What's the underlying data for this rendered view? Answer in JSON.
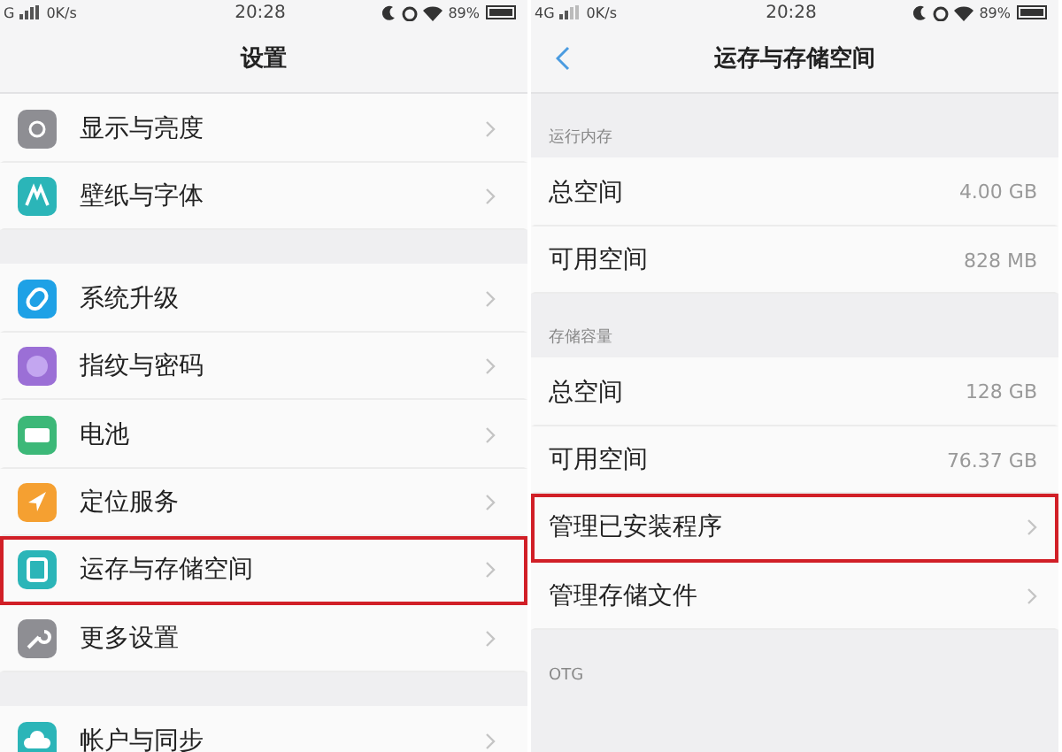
{
  "settings_screen": {
    "status_bar": {
      "network": "G",
      "speed": "0K/s",
      "time": "20:28",
      "battery": "89%"
    },
    "title": "设置",
    "groups": [
      {
        "items": [
          {
            "label": "显示与亮度",
            "color": "#8e8e93",
            "highlighted": false
          },
          {
            "label": "壁纸与字体",
            "color": "#2bb5b8",
            "highlighted": false
          }
        ]
      },
      {
        "items": [
          {
            "label": "系统升级",
            "color": "#1ea1e6",
            "highlighted": false
          },
          {
            "label": "指纹与密码",
            "color": "#9b6fd6",
            "highlighted": false
          },
          {
            "label": "电池",
            "color": "#3cb878",
            "highlighted": false
          },
          {
            "label": "定位服务",
            "color": "#f5a031",
            "highlighted": false
          },
          {
            "label": "运存与存储空间",
            "color": "#2bb5b8",
            "highlighted": true
          },
          {
            "label": "更多设置",
            "color": "#8e8e93",
            "highlighted": false
          }
        ]
      },
      {
        "items": [
          {
            "label": "帐户与同步",
            "color": "#2bb5b8",
            "highlighted": false
          }
        ]
      }
    ]
  },
  "storage_screen": {
    "status_bar": {
      "network": "4G",
      "speed": "0K/s",
      "time": "20:28",
      "battery": "89%"
    },
    "title": "运存与存储空间",
    "sections": [
      {
        "header": "运行内存",
        "rows": [
          {
            "kind": "value",
            "label": "总空间",
            "value": "4.00 GB",
            "highlighted": false
          },
          {
            "kind": "value",
            "label": "可用空间",
            "value": "828 MB",
            "highlighted": false
          }
        ]
      },
      {
        "header": "存储容量",
        "rows": [
          {
            "kind": "value",
            "label": "总空间",
            "value": "128 GB",
            "highlighted": false
          },
          {
            "kind": "value",
            "label": "可用空间",
            "value": "76.37 GB",
            "highlighted": false
          },
          {
            "kind": "link",
            "label": "管理已安装程序",
            "highlighted": true
          },
          {
            "kind": "link",
            "label": "管理存储文件",
            "highlighted": false
          }
        ]
      },
      {
        "header": "OTG"
      }
    ]
  }
}
